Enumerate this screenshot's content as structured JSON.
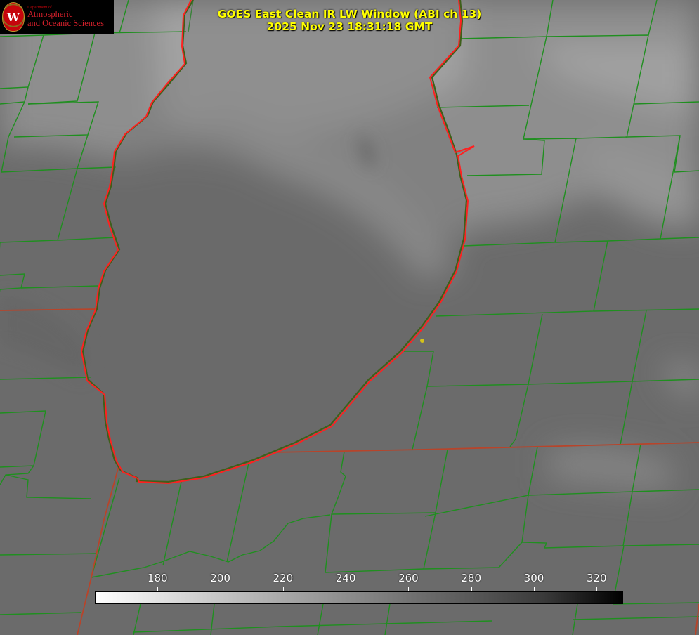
{
  "logo": {
    "department": "Department of",
    "line1": "Atmospheric",
    "line2": "and Oceanic Sciences",
    "seal_letter": "W"
  },
  "title": {
    "line1": "GOES East Clean IR LW Window (ABI ch 13)",
    "line2": "2025 Nov 23 18:31:18 GMT"
  },
  "colorbar": {
    "min": 160,
    "max": 328,
    "ticks": [
      "180",
      "200",
      "220",
      "240",
      "260",
      "280",
      "300",
      "320"
    ],
    "tick_values": [
      180,
      200,
      220,
      240,
      260,
      280,
      300,
      320
    ]
  },
  "colors": {
    "title": "#ffff00",
    "county_borders": "#1f8f1f",
    "state_borders": "#c0392b",
    "lake_outline": "#ff2020",
    "marker": "#d4c21a"
  }
}
